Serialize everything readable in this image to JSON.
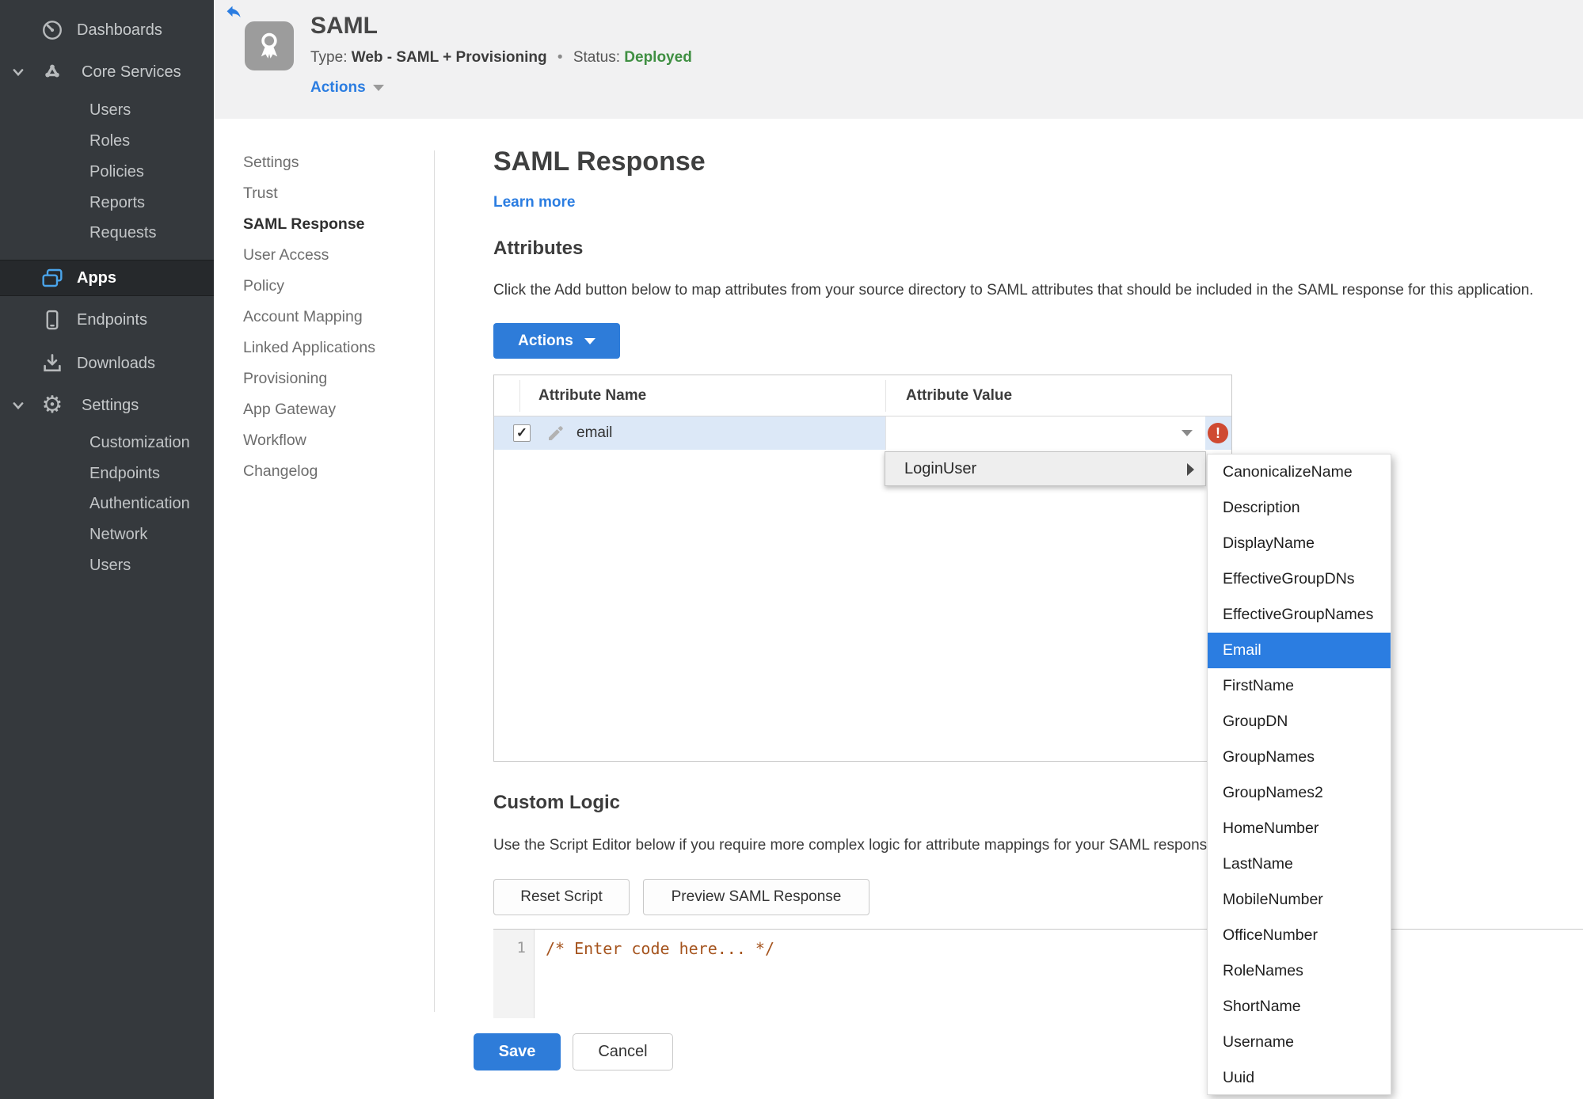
{
  "sidebar": {
    "items": [
      {
        "label": "Dashboards",
        "icon": "gauge-icon"
      },
      {
        "label": "Core Services",
        "icon": "core-services-icon",
        "expanded": true,
        "children": [
          "Users",
          "Roles",
          "Policies",
          "Reports",
          "Requests"
        ]
      },
      {
        "label": "Apps",
        "icon": "apps-icon",
        "active": true
      },
      {
        "label": "Endpoints",
        "icon": "endpoint-device-icon"
      },
      {
        "label": "Downloads",
        "icon": "download-icon"
      },
      {
        "label": "Settings",
        "icon": "gear-icon",
        "expanded": true,
        "children": [
          "Customization",
          "Endpoints",
          "Authentication",
          "Network",
          "Users"
        ]
      }
    ]
  },
  "header": {
    "title": "SAML",
    "type_label": "Type:",
    "type_value": "Web - SAML + Provisioning",
    "separator": "•",
    "status_label": "Status:",
    "status_value": "Deployed",
    "actions_label": "Actions"
  },
  "subnav": {
    "active": "SAML Response",
    "items": [
      "Settings",
      "Trust",
      "SAML Response",
      "User Access",
      "Policy",
      "Account Mapping",
      "Linked Applications",
      "Provisioning",
      "App Gateway",
      "Workflow",
      "Changelog"
    ]
  },
  "content": {
    "page_title": "SAML Response",
    "learn_more_label": "Learn more",
    "attributes": {
      "heading": "Attributes",
      "description": "Click the Add button below to map attributes from your source directory to SAML attributes that should be included in the SAML response for this application.",
      "actions_button_label": "Actions",
      "table": {
        "columns": [
          "Attribute Name",
          "Attribute Value"
        ],
        "rows": [
          {
            "name": "email",
            "value": "",
            "checked": true,
            "has_error": true
          }
        ]
      }
    },
    "value_menu": {
      "root_item": "LoginUser",
      "selected": "Email",
      "options": [
        "CanonicalizeName",
        "Description",
        "DisplayName",
        "EffectiveGroupDNs",
        "EffectiveGroupNames",
        "Email",
        "FirstName",
        "GroupDN",
        "GroupNames",
        "GroupNames2",
        "HomeNumber",
        "LastName",
        "MobileNumber",
        "OfficeNumber",
        "RoleNames",
        "ShortName",
        "Username",
        "Uuid"
      ]
    },
    "custom_logic": {
      "heading": "Custom Logic",
      "description": "Use the Script Editor below if you require more complex logic for attribute mappings for your SAML response.",
      "reset_button_label": "Reset Script",
      "preview_button_label": "Preview SAML Response",
      "editor": {
        "line_number": "1",
        "code": "/* Enter code here... */"
      }
    },
    "save_button_label": "Save",
    "cancel_button_label": "Cancel"
  },
  "colors": {
    "accent_blue": "#2b7de1",
    "status_green": "#3f8f42",
    "error_red": "#cf4a32",
    "selected_row_blue": "#dce8f7",
    "sidebar_bg": "#35393d",
    "code_comment": "#a5541e"
  }
}
